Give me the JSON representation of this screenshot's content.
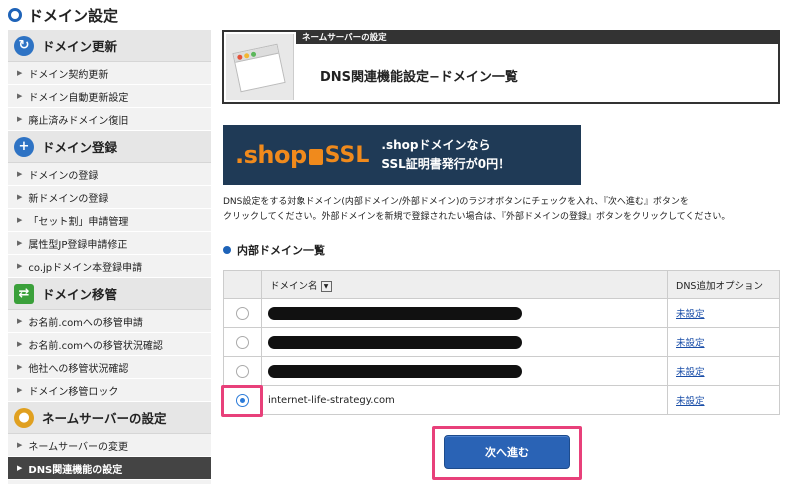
{
  "page": {
    "title": "ドメイン設定"
  },
  "sidebar": {
    "groups": [
      {
        "heading": "ドメイン更新",
        "icon": "refresh-icon",
        "items": [
          "ドメイン契約更新",
          "ドメイン自動更新設定",
          "廃止済みドメイン復旧"
        ]
      },
      {
        "heading": "ドメイン登録",
        "icon": "plus-icon",
        "items": [
          "ドメインの登録",
          "新ドメインの登録",
          "「セット割」申請管理",
          "属性型JP登録申請修正",
          "co.jpドメイン本登録申請"
        ]
      },
      {
        "heading": "ドメイン移管",
        "icon": "transfer-icon",
        "items": [
          "お名前.comへの移管申請",
          "お名前.comへの移管状況確認",
          "他社への移管状況確認",
          "ドメイン移管ロック"
        ]
      },
      {
        "heading": "ネームサーバーの設定",
        "icon": "person-icon",
        "items": [
          "ネームサーバーの変更",
          "DNS関連機能の設定"
        ],
        "active_item": "DNS関連機能の設定"
      }
    ]
  },
  "header": {
    "strip_label": "ネームサーバーの設定",
    "heading": "DNS関連機能設定−ドメイン一覧"
  },
  "banner": {
    "logo_text": ".shop",
    "ssl_text": "SSL",
    "line1": ".shopドメインなら",
    "line2": "SSL証明書発行が0円！"
  },
  "instructions": {
    "line1": "DNS設定をする対象ドメイン(内部ドメイン/外部ドメイン)のラジオボタンにチェックを入れ、『次へ進む』ボタンを",
    "line2": "クリックしてください。外部ドメインを新規で登録されたい場合は、『外部ドメインの登録』ボタンをクリックしてください。"
  },
  "section": {
    "title": "内部ドメイン一覧"
  },
  "table": {
    "col_name": "ドメイン名",
    "col_option": "DNS追加オプション",
    "rows": [
      {
        "domain": "",
        "redacted": true,
        "option": "未設定",
        "selected": false
      },
      {
        "domain": "",
        "redacted": true,
        "option": "未設定",
        "selected": false
      },
      {
        "domain": "",
        "redacted": true,
        "option": "未設定",
        "selected": false
      },
      {
        "domain": "internet-life-strategy.com",
        "redacted": false,
        "option": "未設定",
        "selected": true
      }
    ]
  },
  "next_button": {
    "label": "次へ進む"
  },
  "colors": {
    "accent": "#1e63b8",
    "highlight": "#e8407a",
    "banner_bg": "#1f3a56",
    "banner_orange": "#f08a1c"
  }
}
